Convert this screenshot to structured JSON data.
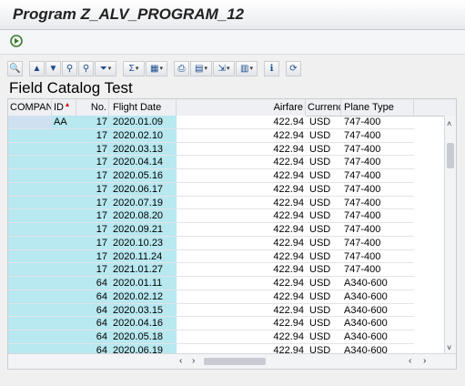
{
  "window": {
    "title": "Program Z_ALV_PROGRAM_12"
  },
  "toolbar": {
    "buttons": [
      {
        "icon": "details-icon"
      },
      {
        "icon": "sort-ascending-icon"
      },
      {
        "icon": "sort-descending-icon"
      },
      {
        "icon": "find-icon"
      },
      {
        "icon": "find-next-icon"
      },
      {
        "icon": "filter-icon"
      },
      {
        "icon": "sum-icon"
      },
      {
        "icon": "subtotal-icon"
      },
      {
        "icon": "print-icon"
      },
      {
        "icon": "views-icon"
      },
      {
        "icon": "export-icon"
      },
      {
        "icon": "layout-icon"
      },
      {
        "icon": "info-icon"
      },
      {
        "icon": "refresh-icon"
      }
    ]
  },
  "grid": {
    "title": "Field Catalog Test",
    "columns": [
      "COMPAN",
      "ID",
      "No.",
      "Flight Date",
      "Airfare",
      "Currency",
      "Plane Type"
    ],
    "rows": [
      [
        "",
        "AA",
        "17",
        "2020.01.09",
        "422.94",
        "USD",
        "747-400"
      ],
      [
        "",
        "",
        "17",
        "2020.02.10",
        "422.94",
        "USD",
        "747-400"
      ],
      [
        "",
        "",
        "17",
        "2020.03.13",
        "422.94",
        "USD",
        "747-400"
      ],
      [
        "",
        "",
        "17",
        "2020.04.14",
        "422.94",
        "USD",
        "747-400"
      ],
      [
        "",
        "",
        "17",
        "2020.05.16",
        "422.94",
        "USD",
        "747-400"
      ],
      [
        "",
        "",
        "17",
        "2020.06.17",
        "422.94",
        "USD",
        "747-400"
      ],
      [
        "",
        "",
        "17",
        "2020.07.19",
        "422.94",
        "USD",
        "747-400"
      ],
      [
        "",
        "",
        "17",
        "2020.08.20",
        "422.94",
        "USD",
        "747-400"
      ],
      [
        "",
        "",
        "17",
        "2020.09.21",
        "422.94",
        "USD",
        "747-400"
      ],
      [
        "",
        "",
        "17",
        "2020.10.23",
        "422.94",
        "USD",
        "747-400"
      ],
      [
        "",
        "",
        "17",
        "2020.11.24",
        "422.94",
        "USD",
        "747-400"
      ],
      [
        "",
        "",
        "17",
        "2021.01.27",
        "422.94",
        "USD",
        "747-400"
      ],
      [
        "",
        "",
        "64",
        "2020.01.11",
        "422.94",
        "USD",
        "A340-600"
      ],
      [
        "",
        "",
        "64",
        "2020.02.12",
        "422.94",
        "USD",
        "A340-600"
      ],
      [
        "",
        "",
        "64",
        "2020.03.15",
        "422.94",
        "USD",
        "A340-600"
      ],
      [
        "",
        "",
        "64",
        "2020.04.16",
        "422.94",
        "USD",
        "A340-600"
      ],
      [
        "",
        "",
        "64",
        "2020.05.18",
        "422.94",
        "USD",
        "A340-600"
      ],
      [
        "",
        "",
        "64",
        "2020.06.19",
        "422.94",
        "USD",
        "A340-600"
      ]
    ]
  },
  "colors": {
    "key_column_bg": "#b8e8f0",
    "sort_indicator": "#cc0000"
  }
}
